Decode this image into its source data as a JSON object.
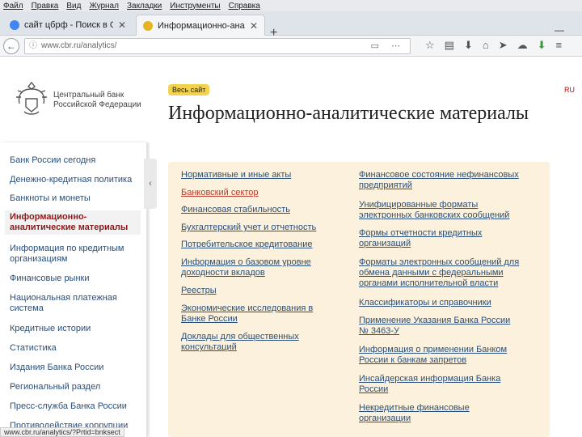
{
  "menubar": [
    "Файл",
    "Правка",
    "Вид",
    "Журнал",
    "Закладки",
    "Инструменты",
    "Справка"
  ],
  "tabs": [
    {
      "title": "сайт цбрф - Поиск в Goo...",
      "icon": "google-icon",
      "color": "#4285f4"
    },
    {
      "title": "Информационно-аналит...",
      "icon": "cbr-favicon-icon",
      "color": "#e6b422"
    }
  ],
  "url": "www.cbr.ru/analytics/",
  "header": {
    "bank_name_line1": "Центральный банк",
    "bank_name_line2": "Российской Федерации",
    "badge": "Весь сайт",
    "right_link": "RU",
    "title": "Информационно-аналитические материалы"
  },
  "sidebar": {
    "items": [
      "Банк России сегодня",
      "Денежно-кредитная политика",
      "Банкноты и монеты",
      "Информационно-аналитические материалы",
      "Информация по кредитным организациям",
      "Финансовые рынки",
      "Национальная платежная система",
      "Кредитные истории",
      "Статистика",
      "Издания Банка России",
      "Региональный раздел",
      "Пресс-служба Банка России",
      "Противодействие коррупции"
    ],
    "collapse": "‹"
  },
  "links_left": [
    "Нормативные и иные акты",
    "Банковский сектор",
    "Финансовая стабильность",
    "Бухгалтерский учет и отчетность",
    "Потребительское кредитование",
    "Информация о базовом уровне доходности вкладов",
    "Реестры",
    "Экономические исследования в Банке России",
    "Доклады для общественных консультаций"
  ],
  "links_right": [
    "Финансовое состояние нефинансовых предприятий",
    "Унифицированные форматы электронных банковских сообщений",
    "Формы отчетности кредитных организаций",
    "Форматы электронных сообщений для обмена данными с федеральными органами исполнительной власти",
    "Классификаторы и справочники",
    "Применение Указания Банка России № 3463-У",
    "Информация о применении Банком России к банкам запретов",
    "Инсайдерская информация Банка России",
    "Некредитные финансовые организации"
  ],
  "status": "www.cbr.ru/analytics/?Prtid=bnksect"
}
